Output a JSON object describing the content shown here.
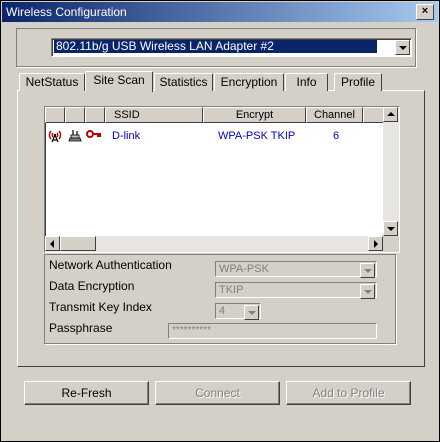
{
  "window": {
    "title": "Wireless Configuration",
    "close_label": "×"
  },
  "adapter": {
    "selected": "802.11b/g USB Wireless LAN Adapter #2"
  },
  "tabs": [
    {
      "label": "NetStatus"
    },
    {
      "label": "Site Scan",
      "active": true
    },
    {
      "label": "Statistics"
    },
    {
      "label": "Encryption"
    },
    {
      "label": "Info"
    },
    {
      "label": "Profile"
    }
  ],
  "site_list": {
    "columns": [
      "",
      "",
      "",
      "SSID",
      "Encrypt",
      "Channel"
    ],
    "rows": [
      {
        "icons": [
          "signal-antenna-icon",
          "infrastructure-network-icon",
          "security-key-icon"
        ],
        "ssid": "D-link",
        "encrypt": "WPA-PSK TKIP",
        "channel": "6"
      }
    ]
  },
  "security": {
    "network_auth_label": "Network Authentication",
    "network_auth_value": "WPA-PSK",
    "data_enc_label": "Data Encryption",
    "data_enc_value": "TKIP",
    "tx_key_label": "Transmit Key Index",
    "tx_key_value": "4",
    "passphrase_label": "Passphrase",
    "passphrase_value": "**********"
  },
  "buttons": {
    "refresh": "Re-Fresh",
    "connect": "Connect",
    "add_profile": "Add to Profile"
  },
  "colors": {
    "title_start": "#0a246a",
    "title_end": "#a6caf0",
    "row_text": "#0000c0",
    "selection": "#0a246a"
  }
}
